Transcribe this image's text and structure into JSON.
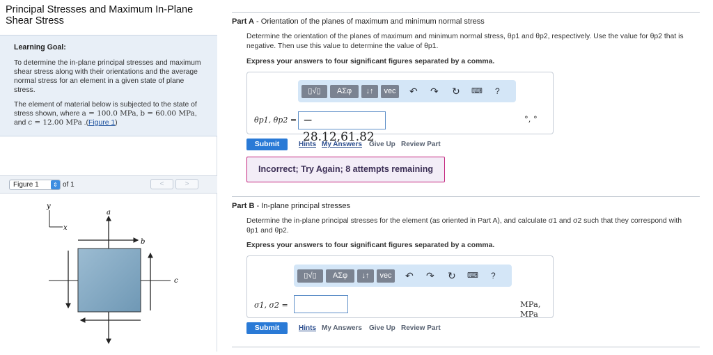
{
  "sidebar": {
    "title": "Principal Stresses and Maximum In-Plane Shear Stress",
    "learning_goal_label": "Learning Goal:",
    "goal_text": "To determine the in-plane principal stresses and maximum shear stress along with their orientations and the average normal stress for an element in a given state of plane stress.",
    "element_text_prefix": "The element of material below is subjected to the state of stress shown, where ",
    "a_val": "a = 100.0 MPa",
    "b_val": "b = 60.00 MPa",
    "c_val": "c = 12.00 MPa",
    "figure_link": "Figure 1",
    "figure_select": "Figure 1",
    "figure_of": "of 1",
    "nav_prev": "<",
    "nav_next": ">"
  },
  "figure": {
    "label_y": "y",
    "label_x": "x",
    "label_a": "a",
    "label_b": "b",
    "label_c": "c",
    "element_color": "#7fa7c2"
  },
  "partA": {
    "label": "Part A",
    "title": "Orientation of the planes of maximum and minimum normal stress",
    "description_1": "Determine the orientation of the planes of maximum and minimum normal stress, θp1 and θp2, respectively. Use the value for θp2 that is",
    "description_2": "negative. Then use this value to determine the value of θp1.",
    "instruction": "Express your answers to four significant figures separated by a comma.",
    "variable_label": "θp1, θp2 =",
    "input_value": "− 28.12,61.82",
    "units": "°, °",
    "submit": "Submit",
    "hints": "Hints",
    "my_answers": "My Answers",
    "give_up": "Give Up",
    "review_part": "Review Part",
    "feedback": "Incorrect; Try Again; 8 attempts remaining"
  },
  "partB": {
    "label": "Part B",
    "title": "In-plane principal stresses",
    "description_1": "Determine the in-plane principal stresses for the element (as oriented in Part A), and calculate σ1 and σ2 such that they correspond with",
    "description_2": "θp1 and θp2.",
    "instruction": "Express your answers to four significant figures separated by a comma.",
    "variable_label": "σ1, σ2 =",
    "input_value": "",
    "units": "MPa, MPa",
    "submit": "Submit",
    "hints": "Hints",
    "my_answers": "My Answers",
    "give_up": "Give Up",
    "review_part": "Review Part"
  },
  "toolbar": {
    "templates": "▯√▯",
    "greek": "ΑΣφ",
    "arrows": "↓↑",
    "vec": "vec",
    "help": "?"
  },
  "colors": {
    "accent": "#2a7ad6",
    "goal_bg": "#e8eff7",
    "toolbar_bg": "#d4e6f7",
    "error_border": "#c4237c"
  }
}
